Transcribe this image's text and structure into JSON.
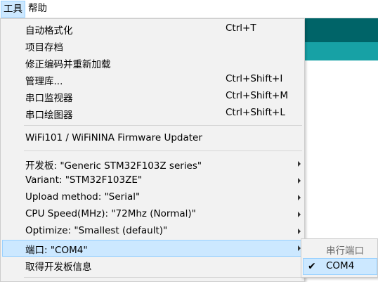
{
  "menubar": {
    "items": [
      {
        "label": "工具"
      },
      {
        "label": "帮助"
      }
    ]
  },
  "colors": {
    "highlight": "#cce8ff",
    "highlight_border": "#99d1ff",
    "editor_dark": "#006468",
    "editor_light": "#17a1a5"
  },
  "tools_menu": {
    "items": [
      {
        "label": "自动格式化",
        "shortcut": "Ctrl+T"
      },
      {
        "label": "项目存档",
        "shortcut": ""
      },
      {
        "label": "修正编码并重新加载",
        "shortcut": ""
      },
      {
        "label": "管理库...",
        "shortcut": "Ctrl+Shift+I"
      },
      {
        "label": "串口监视器",
        "shortcut": "Ctrl+Shift+M"
      },
      {
        "label": "串口绘图器",
        "shortcut": "Ctrl+Shift+L"
      },
      {
        "label": "WiFi101 / WiFiNINA Firmware Updater",
        "shortcut": ""
      },
      {
        "label": "开发板: \"Generic STM32F103Z series\"",
        "shortcut": ""
      },
      {
        "label": "Variant: \"STM32F103ZE\"",
        "shortcut": ""
      },
      {
        "label": "Upload method: \"Serial\"",
        "shortcut": ""
      },
      {
        "label": "CPU Speed(MHz): \"72Mhz (Normal)\"",
        "shortcut": ""
      },
      {
        "label": "Optimize: \"Smallest (default)\"",
        "shortcut": ""
      },
      {
        "label": "端口: \"COM4\"",
        "shortcut": ""
      },
      {
        "label": "取得开发板信息",
        "shortcut": ""
      }
    ]
  },
  "port_submenu": {
    "header": "串行端口",
    "options": [
      {
        "label": "COM4",
        "checked": true,
        "check_mark": "✔"
      }
    ]
  }
}
